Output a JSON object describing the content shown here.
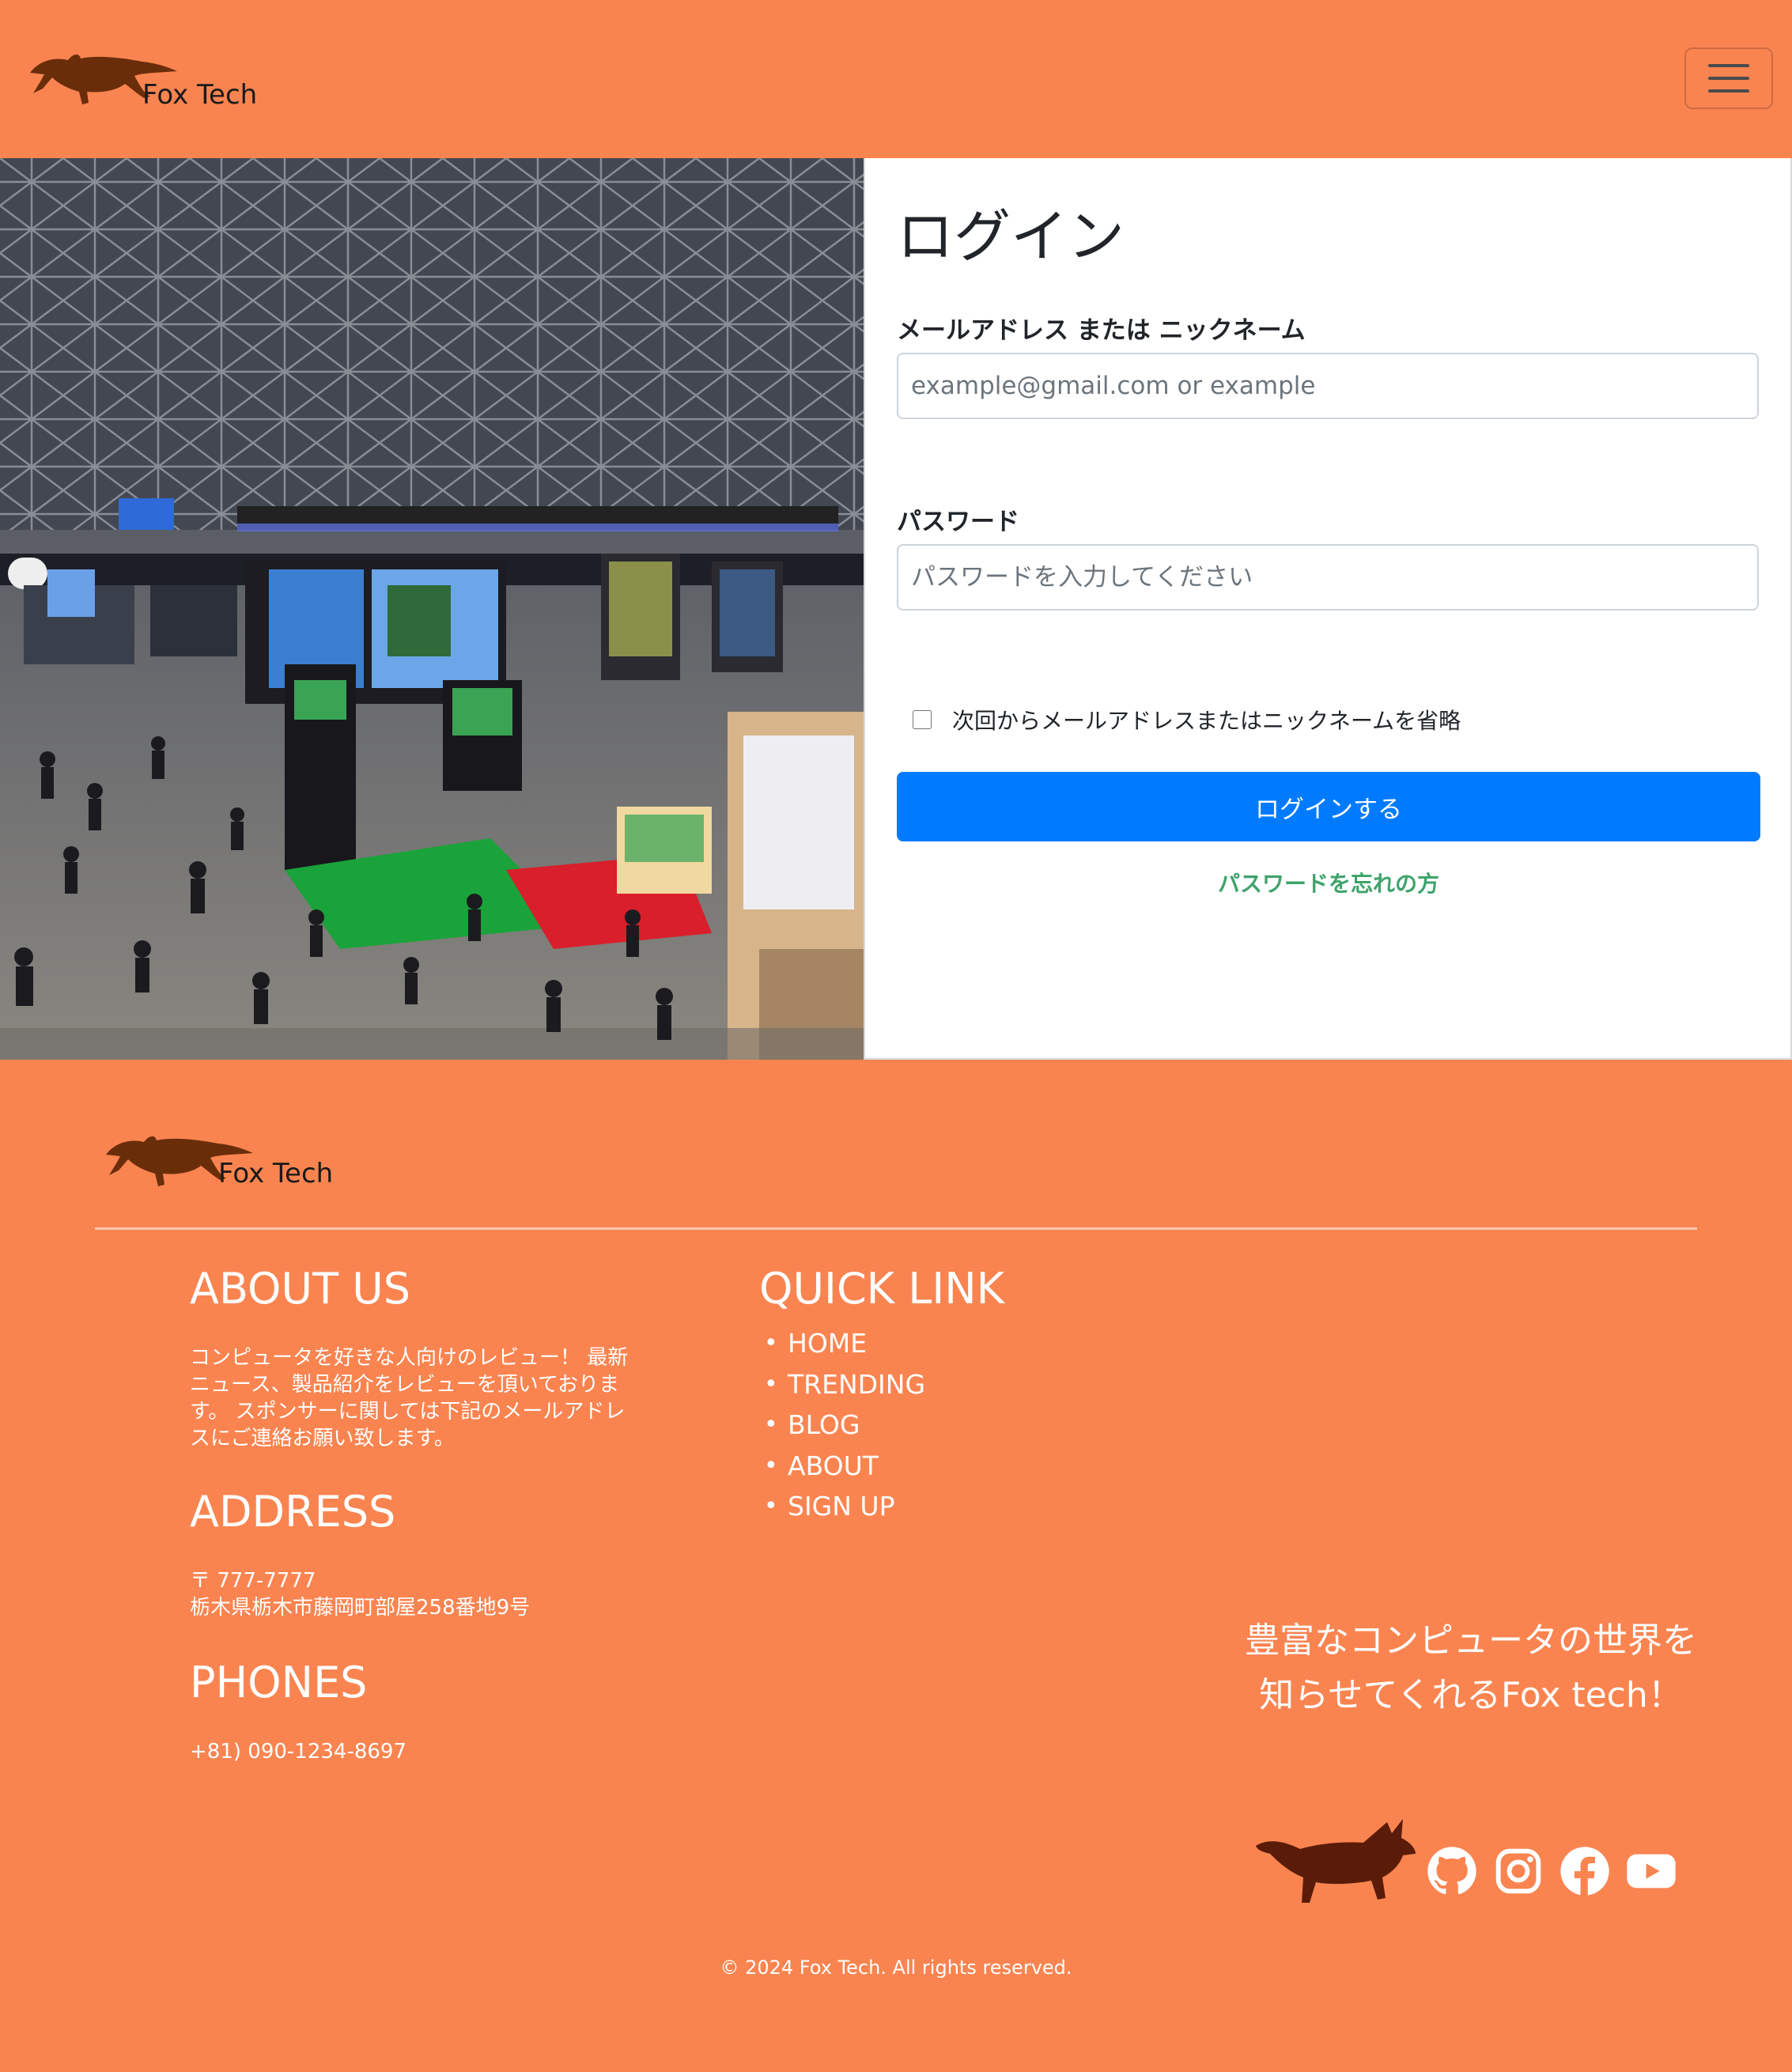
{
  "header": {
    "brand": "Fox Tech",
    "menu_toggle": "menu"
  },
  "login": {
    "title": "ログイン",
    "email_label": "メールアドレス または ニックネーム",
    "email_placeholder": "example@gmail.com or example",
    "email_value": "",
    "password_label": "パスワード",
    "password_placeholder": "パスワードを入力してください",
    "password_value": "",
    "remember_label": "次回からメールアドレスまたはニックネームを省略",
    "remember_checked": false,
    "submit_label": "ログインする",
    "forgot_label": "パスワードを忘れの方"
  },
  "footer": {
    "brand": "Fox Tech",
    "about_title": "ABOUT US",
    "about_text": "コンピュータを好きな人向けのレビュー！ 最新ニュース、製品紹介をレビューを頂いております。 スポンサーに関しては下記のメールアドレスにご連絡お願い致します。",
    "address_title": "ADDRESS",
    "address_postal": "〒 777-7777",
    "address_line": "栃木県栃木市藤岡町部屋258番地9号",
    "phones_title": "PHONES",
    "phone": "+81) 090-1234-8697",
    "quick_title": "QUICK LINK",
    "quick_links": [
      "HOME",
      "TRENDING",
      "BLOG",
      "ABOUT",
      "SIGN UP"
    ],
    "tagline": "豊富なコンピュータの世界を 知らせてくれるFox tech！",
    "social": [
      "github-icon",
      "instagram-icon",
      "facebook-icon",
      "youtube-icon"
    ],
    "copyright": "© 2024 Fox Tech. All rights reserved."
  },
  "colors": {
    "brand_orange": "#fa8450",
    "primary_button": "#007bff",
    "forgot_link": "#3fa36b",
    "fox_dark": "#5a2408"
  }
}
